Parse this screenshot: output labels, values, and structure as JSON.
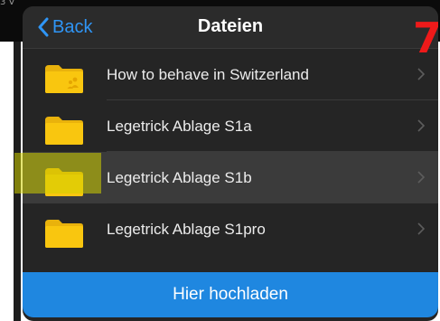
{
  "corner_text": "3 V",
  "navbar": {
    "back_label": "Back",
    "title": "Dateien"
  },
  "badge": "7",
  "folders": [
    {
      "label": "How to behave in Switzerland",
      "shared": true,
      "selected": false
    },
    {
      "label": "Legetrick Ablage S1a",
      "shared": false,
      "selected": false
    },
    {
      "label": "Legetrick Ablage S1b",
      "shared": false,
      "selected": true
    },
    {
      "label": "Legetrick Ablage S1pro",
      "shared": false,
      "selected": false
    }
  ],
  "upload_button": "Hier hochladen",
  "icons": {
    "back": "chevron-left-icon",
    "folder": "folder-icon",
    "shared_folder": "shared-folder-icon",
    "disclosure": "chevron-right-icon"
  },
  "colors": {
    "accent": "#2f95f5",
    "upload": "#1f87e0",
    "folder": "#f9c60f",
    "badge": "#ee1a1a",
    "highlight": "#d2d200"
  }
}
